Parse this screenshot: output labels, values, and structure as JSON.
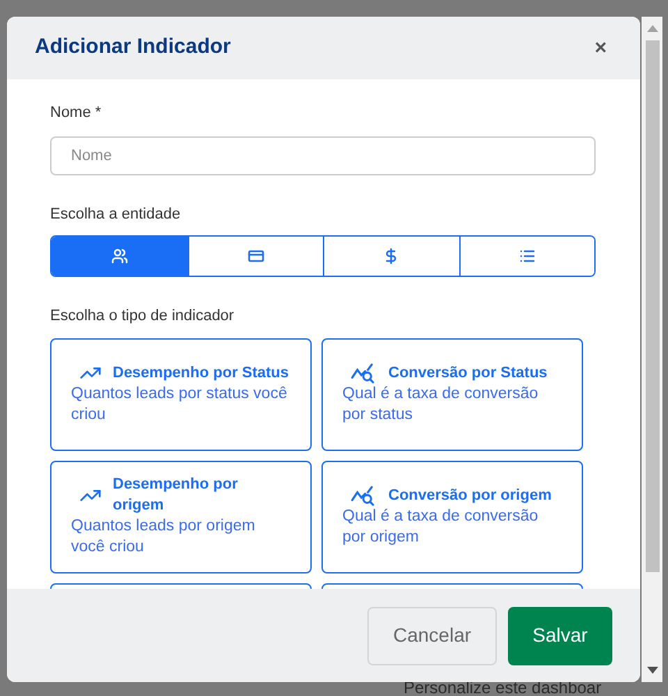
{
  "background_text": "Personalize este dashboar",
  "dialog": {
    "title": "Adicionar Indicador",
    "close": "×"
  },
  "name_field": {
    "label": "Nome *",
    "placeholder": "Nome"
  },
  "entity": {
    "label": "Escolha a entidade",
    "options": [
      {
        "kind": "people",
        "selected": true
      },
      {
        "kind": "card",
        "selected": false
      },
      {
        "kind": "money",
        "selected": false
      },
      {
        "kind": "list",
        "selected": false
      }
    ]
  },
  "indicator": {
    "label": "Escolha o tipo de indicador",
    "cards": [
      {
        "kind": "trend",
        "title": "Desempenho por Status",
        "description": "Quantos leads por status você criou"
      },
      {
        "kind": "conversion",
        "title": "Conversão por Status",
        "description": "Qual é a taxa de conversão por status"
      },
      {
        "kind": "trend",
        "title": "Desempenho por origem",
        "description": "Quantos leads por origem você criou"
      },
      {
        "kind": "conversion",
        "title": "Conversão por origem",
        "description": "Qual é a taxa de conversão por origem"
      },
      {
        "kind": "hidden"
      },
      {
        "kind": "hidden"
      }
    ]
  },
  "buttons": [
    {
      "kind": "cancel",
      "label": "Cancelar"
    },
    {
      "kind": "save",
      "label": "Salvar"
    }
  ]
}
